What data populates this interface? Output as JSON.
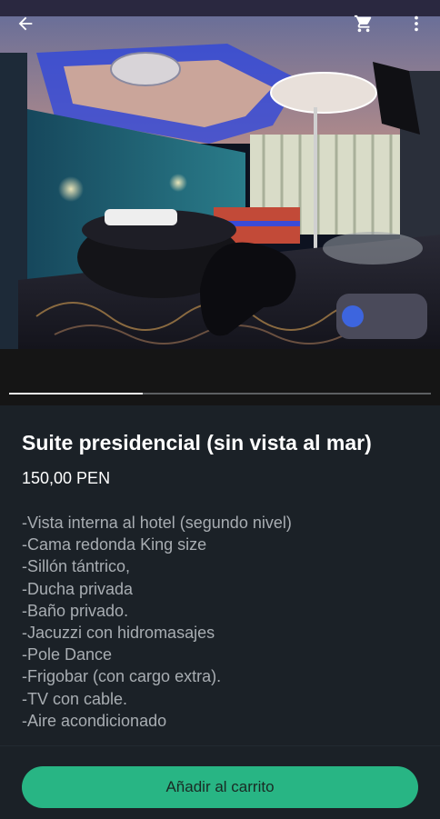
{
  "topbar": {
    "back_icon": "arrow-left-icon",
    "cart_icon": "shopping-cart-icon",
    "more_icon": "more-vertical-icon"
  },
  "gallery": {
    "image_description": "hotel suite photo",
    "progress_fraction": 0.316
  },
  "product": {
    "title": "Suite presidencial (sin vista al mar)",
    "price": "150,00 PEN",
    "features": [
      "-Vista interna al hotel (segundo nivel)",
      "-Cama redonda King size",
      "-Sillón tántrico,",
      "-Ducha privada",
      "-Baño privado.",
      "-Jacuzzi con hidromasajes",
      "-Pole Dance",
      "-Frigobar (con cargo extra).",
      "-TV con cable.",
      "-Aire acondicionado"
    ]
  },
  "actions": {
    "add_to_cart_label": "Añadir al carrito"
  },
  "colors": {
    "background": "#1b2127",
    "accent": "#28b584",
    "muted_text": "#a8adb2"
  }
}
